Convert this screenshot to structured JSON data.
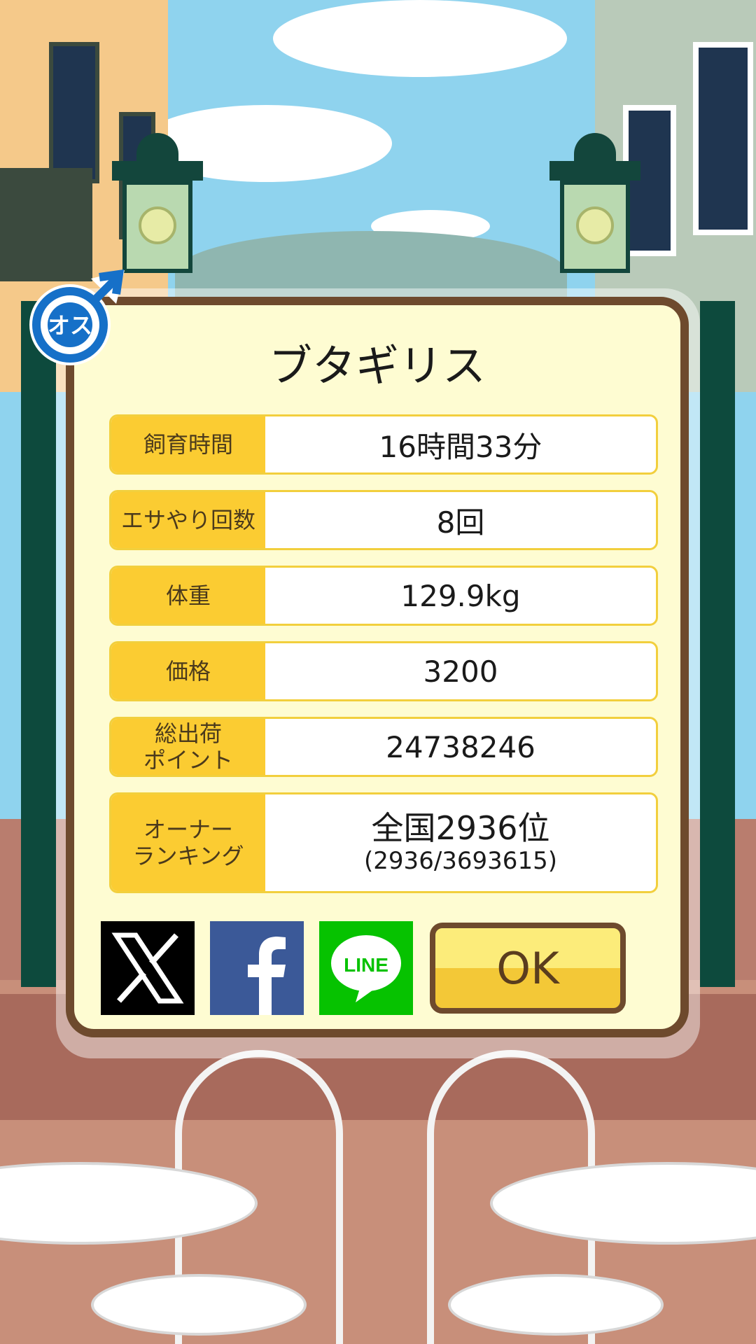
{
  "pig": {
    "name": "ブタギリス",
    "gender_badge": "オス"
  },
  "stats": [
    {
      "label": "飼育時間",
      "value": "16時間33分"
    },
    {
      "label": "エサやり回数",
      "value": "8回"
    },
    {
      "label": "体重",
      "value": "129.9kg"
    },
    {
      "label": "価格",
      "value": "3200"
    },
    {
      "label_line1": "総出荷",
      "label_line2": "ポイント",
      "value": "24738246"
    }
  ],
  "ranking": {
    "label_line1": "オーナー",
    "label_line2": "ランキング",
    "main": "全国2936位",
    "sub": "(2936/3693615)"
  },
  "share": {
    "x_icon": "x-logo-icon",
    "facebook_icon": "facebook-logo-icon",
    "line_icon": "line-logo-icon",
    "line_text": "LINE"
  },
  "ok_label": "OK",
  "colors": {
    "label_bg": "#fbcc32",
    "panel_bg": "#fefcd2",
    "frame": "#6e4a2d",
    "male_blue": "#1670c8"
  }
}
